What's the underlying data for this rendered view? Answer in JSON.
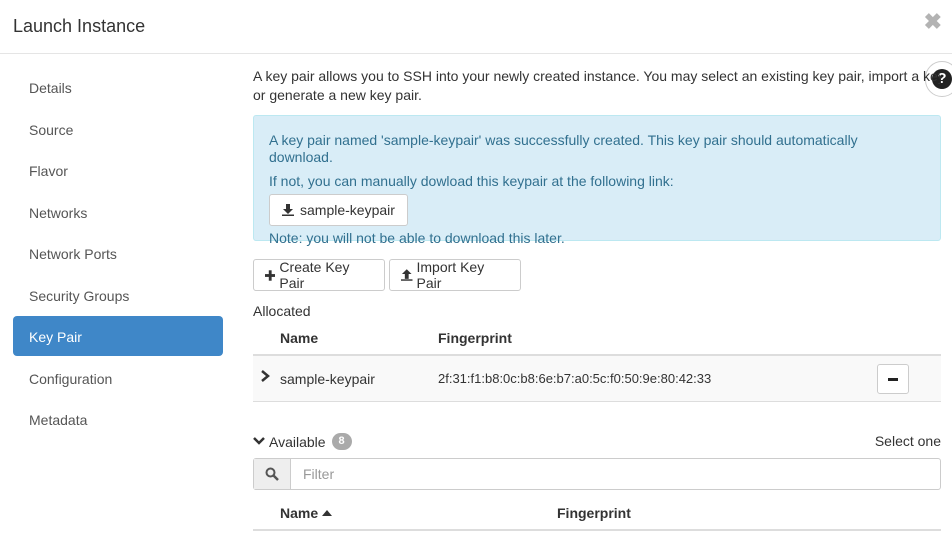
{
  "header": {
    "title": "Launch Instance",
    "close": "✖"
  },
  "sidebar": {
    "items": [
      {
        "label": "Details"
      },
      {
        "label": "Source"
      },
      {
        "label": "Flavor"
      },
      {
        "label": "Networks"
      },
      {
        "label": "Network Ports"
      },
      {
        "label": "Security Groups"
      },
      {
        "label": "Key Pair",
        "active": true
      },
      {
        "label": "Configuration"
      },
      {
        "label": "Metadata"
      }
    ]
  },
  "main": {
    "intro_line1": "A key pair allows you to SSH into your newly created instance. You may select an existing key pair, import a key pair,",
    "intro_line2": "or generate a new key pair.",
    "help": "?",
    "alert": {
      "line1": "A key pair named 'sample-keypair' was successfully created. This key pair should automatically download.",
      "line2": "If not, you can manually dowload this keypair at the following link:",
      "download_label": "sample-keypair",
      "line3": "Note: you will not be able to download this later."
    },
    "create_label": "Create Key Pair",
    "import_label": "Import Key Pair",
    "allocated": {
      "title": "Allocated",
      "col_name": "Name",
      "col_fingerprint": "Fingerprint",
      "rows": [
        {
          "name": "sample-keypair",
          "fingerprint": "2f:31:f1:b8:0c:b8:6e:b7:a0:5c:f0:50:9e:80:42:33"
        }
      ]
    },
    "available": {
      "title": "Available",
      "count": "8",
      "select_one": "Select one",
      "filter_placeholder": "Filter",
      "col_name": "Name",
      "col_fingerprint": "Fingerprint"
    }
  }
}
